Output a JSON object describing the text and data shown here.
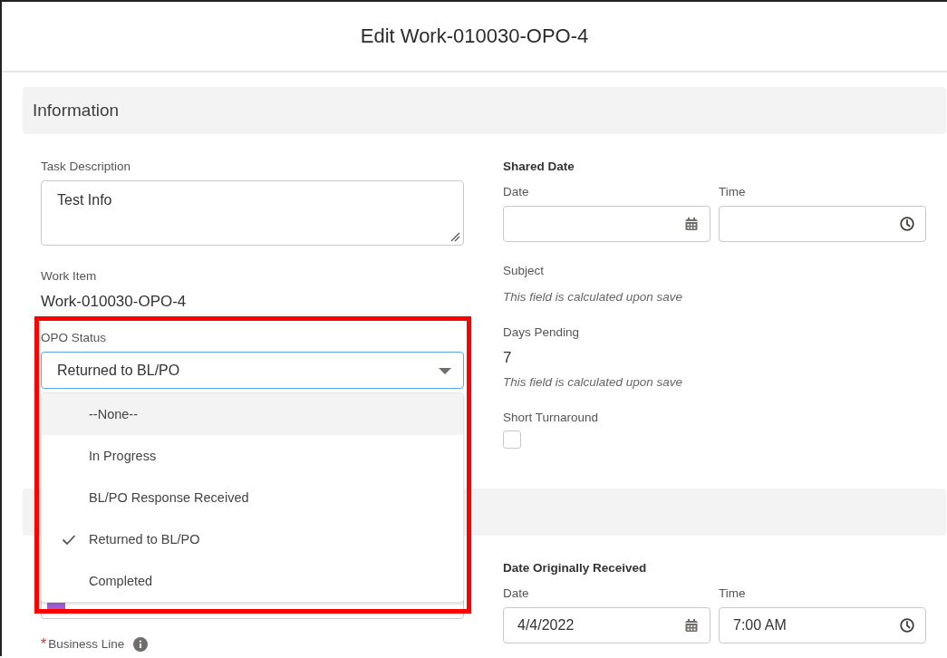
{
  "dialog": {
    "title": "Edit Work-010030-OPO-4"
  },
  "information": {
    "title": "Information",
    "left": [
      {
        "kind": "textarea",
        "label": "Task Description",
        "value": "Test Info"
      },
      {
        "kind": "readonly",
        "label": "Work Item",
        "value": "Work-010030-OPO-4"
      },
      {
        "kind": "picklist",
        "label": "OPO Status",
        "value": "Returned to BL/PO",
        "expanded": true,
        "highlighted": true,
        "options": [
          {
            "label": "--None--",
            "focused": true,
            "selected": false
          },
          {
            "label": "In Progress",
            "focused": false,
            "selected": false
          },
          {
            "label": "BL/PO Response Received",
            "focused": false,
            "selected": false
          },
          {
            "label": "Returned to BL/PO",
            "focused": false,
            "selected": true
          },
          {
            "label": "Completed",
            "focused": false,
            "selected": false
          }
        ]
      }
    ],
    "right": [
      {
        "kind": "datetime",
        "label": "Shared Date",
        "date_label": "Date",
        "time_label": "Time"
      },
      {
        "kind": "calculated",
        "label": "Subject",
        "note": "This field is calculated upon save"
      },
      {
        "kind": "calculated",
        "label": "Days Pending",
        "value": "7",
        "note": "This field is calculated upon save"
      },
      {
        "kind": "checkbox",
        "label": "Short Turnaround",
        "checked": false
      }
    ]
  },
  "section_2": {
    "left": [
      {
        "kind": "lookup"
      },
      {
        "kind": "text",
        "label": "Business Line",
        "required": true,
        "required_mark": "*",
        "info": true
      }
    ],
    "right": [
      {
        "kind": "datetime",
        "label": "Date Originally Received",
        "date_label": "Date",
        "time_label": "Time",
        "date_value": "4/4/2022",
        "time_value": "7:00 AM"
      }
    ]
  }
}
